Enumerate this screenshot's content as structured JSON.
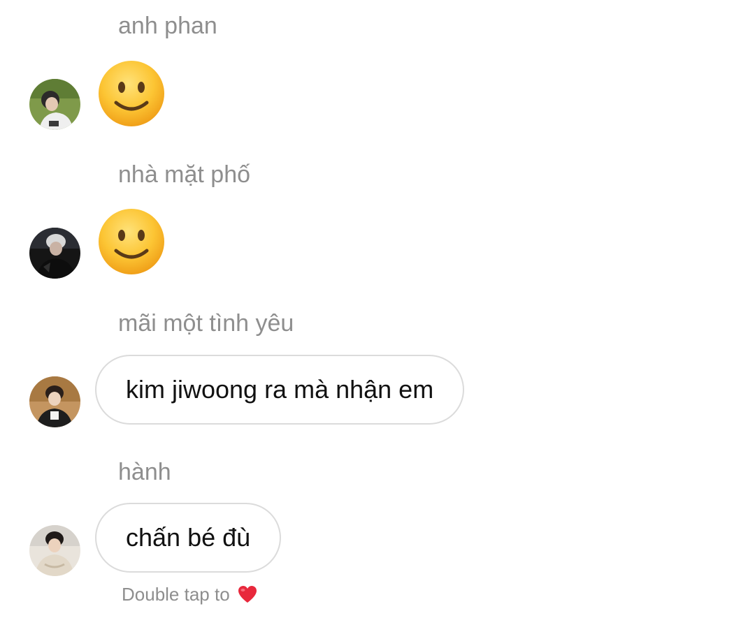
{
  "messages": [
    {
      "sender": "anh phan",
      "type": "emoji",
      "content_icon": "slightly-smiling-face",
      "avatar_icon": "user-avatar"
    },
    {
      "sender": "nhà mặt phố",
      "type": "emoji",
      "content_icon": "slightly-smiling-face",
      "avatar_icon": "user-avatar"
    },
    {
      "sender": "mãi một tình yêu",
      "type": "text",
      "text": "kim jiwoong ra mà nhận em",
      "avatar_icon": "user-avatar"
    },
    {
      "sender": "hành",
      "type": "text",
      "text": "chấn bé đù",
      "avatar_icon": "user-avatar"
    }
  ],
  "hint": {
    "text": "Double tap to",
    "icon": "red-heart"
  },
  "colors": {
    "sender_text": "#8e8e8e",
    "bubble_border": "#dbdbdb",
    "message_text": "#111111",
    "heart": "#e8283c"
  }
}
